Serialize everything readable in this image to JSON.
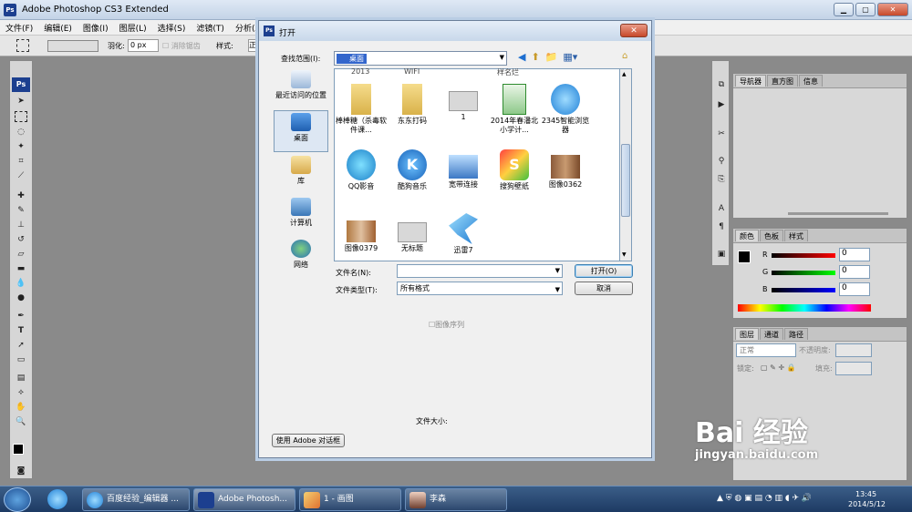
{
  "app": {
    "title": "Adobe Photoshop CS3 Extended"
  },
  "menu": [
    "文件(F)",
    "编辑(E)",
    "图像(I)",
    "图层(L)",
    "选择(S)",
    "滤镜(T)",
    "分析(A)"
  ],
  "options": {
    "feather_label": "羽化:",
    "feather_value": "0 px",
    "antialias": "消除锯齿",
    "style_label": "样式:",
    "style_value": "正"
  },
  "toolbox": {
    "logo": "Ps"
  },
  "dialog": {
    "title": "打开",
    "lookin_label": "查找范围(I):",
    "lookin_value": "桌面",
    "places": [
      {
        "label": "最近访问的位置"
      },
      {
        "label": "桌面"
      },
      {
        "label": "库"
      },
      {
        "label": "计算机"
      },
      {
        "label": "网络"
      }
    ],
    "partial_top_labels": [
      "2013",
      "WIFI",
      "样名烂"
    ],
    "files": [
      {
        "label": "棒棒糖（杀毒软件课...",
        "icon": "folder-icon"
      },
      {
        "label": "东东打码",
        "icon": "folder-icon"
      },
      {
        "label": "1",
        "icon": "image-file-icon"
      },
      {
        "label": "2014年春潘北小学计...",
        "icon": "excel-file-icon"
      },
      {
        "label": "2345智能浏览器",
        "icon": "ie-browser-icon"
      },
      {
        "label": "QQ影音",
        "icon": "qq-player-icon"
      },
      {
        "label": "酷狗音乐",
        "icon": "kugou-icon"
      },
      {
        "label": "宽带连接",
        "icon": "network-connection-icon"
      },
      {
        "label": "搜狗壁纸",
        "icon": "sogou-wallpaper-icon"
      },
      {
        "label": "图像0362",
        "icon": "photo-thumb-icon"
      },
      {
        "label": "图像0379",
        "icon": "photo-thumb-icon"
      },
      {
        "label": "无标题",
        "icon": "image-file-icon"
      },
      {
        "label": "迅雷7",
        "icon": "xunlei-icon"
      }
    ],
    "filename_label": "文件名(N):",
    "filename_value": "",
    "filetype_label": "文件类型(T):",
    "filetype_value": "所有格式",
    "open_button": "打开(O)",
    "cancel_button": "取消",
    "image_sequence": "图像序列",
    "filesize_label": "文件大小:",
    "adobe_dialog_button": "使用 Adobe 对话框"
  },
  "panels": {
    "nav_tabs": [
      "导航器",
      "直方图",
      "信息"
    ],
    "color_tabs": [
      "颜色",
      "色板",
      "样式"
    ],
    "color": {
      "r_label": "R",
      "g_label": "G",
      "b_label": "B",
      "r": "0",
      "g": "0",
      "b": "0"
    },
    "layers_tabs": [
      "图层",
      "通道",
      "路径"
    ],
    "layers": {
      "blend_mode": "正常",
      "opacity_label": "不透明度:",
      "lock_label": "锁定:",
      "fill_label": "填充:"
    }
  },
  "taskbar": {
    "items": [
      {
        "label": "百度经验_编辑器 ..."
      },
      {
        "label": "Adobe Photosh..."
      },
      {
        "label": "1 - 画图"
      },
      {
        "label": "李森"
      }
    ],
    "time": "13:45",
    "date": "2014/5/12"
  },
  "watermark": {
    "main": "Bai 经验",
    "url": "jingyan.baidu.com"
  }
}
